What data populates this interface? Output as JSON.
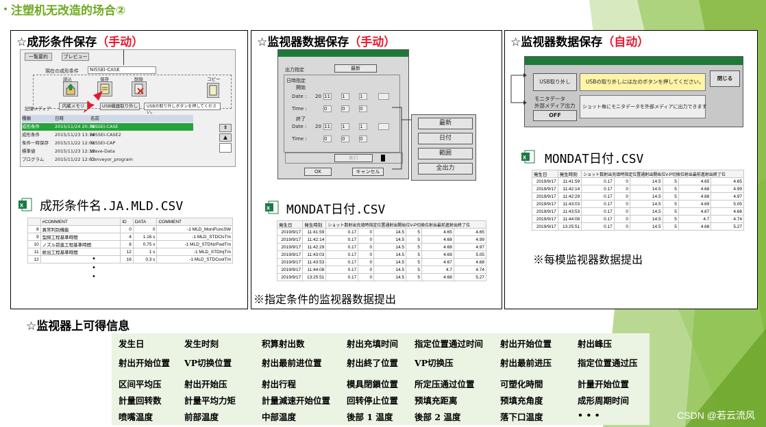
{
  "page": {
    "title": "注塑机无改造的场合②"
  },
  "panels": [
    {
      "title": "☆成形条件保存",
      "mode": "（手动）"
    },
    {
      "title": "☆监视器数据保存",
      "mode": "（手动）"
    },
    {
      "title": "☆监视器数据保存",
      "mode": "（自动）"
    }
  ],
  "screen1": {
    "menu_btn": "一覧要約",
    "preview_btn": "プレビュー",
    "current_label": "現在の成形条件",
    "current_value": "NISSEI-CASE",
    "load": "読込",
    "save": "保存",
    "delete": "削除",
    "copy": "コピー",
    "media_label": "記憶メディア",
    "internal_btn": "内蔵メモリ",
    "usb_btn": "USB機器取り外し",
    "usb_msg": "USBの取り外しボタンを押してください。",
    "headers": [
      "種類",
      "日時",
      "名前"
    ],
    "rows": [
      [
        "成形条件",
        "2015/11/24 20:35",
        "NISSEI-CASE"
      ],
      [
        "成形条件",
        "2015/11/23 13:14",
        "NISSEI-CASE2"
      ],
      [
        "条件一時保存",
        "2015/11/22 12:01",
        "NISSEI-CAP"
      ],
      [
        "標準値",
        "2015/11/23 12:13",
        "Wave-Data"
      ],
      [
        "プログラム",
        "2015/11/22 12:03",
        "Conveyor_program"
      ]
    ]
  },
  "file1": {
    "label": "成形条件名.JA.MLD.CSV",
    "headers": [
      "",
      "#COMMENT",
      "ID",
      "DATA",
      "COMMENT"
    ],
    "rows": [
      [
        "8",
        "異常判別機能",
        "0",
        "0",
        "-1 MLD_MoniFuncSW"
      ],
      [
        "9",
        "型締工程基準時間",
        "4",
        "1.16 s",
        "-1 MLD_STDClsTm"
      ],
      [
        "10",
        "ノズル前進工程基準時間",
        "8",
        "0.75 s",
        "-1 MLD_STDNzFwdTm"
      ],
      [
        "11",
        "射出工程基準時間",
        "12",
        "1 s",
        "-1 MLD_STDInjTm"
      ],
      [
        "12",
        "",
        "16",
        "0.3 s",
        "-1 MLD_STDCoolTm"
      ]
    ],
    "dots": [
      "•",
      "•",
      "•"
    ]
  },
  "screen2": {
    "output_label": "出力指定",
    "latest_btn": "最新",
    "date_spec": "日時指定",
    "start": "開始",
    "end": "終了",
    "date_label": "Date :",
    "time_label": "Time :",
    "year_prefix": "20",
    "values_a": [
      "11",
      "1",
      "1"
    ],
    "values_b": [
      "0",
      "0",
      "0"
    ],
    "exec_btn": "実行",
    "ok_btn": "OK",
    "cancel_btn": "キャンセル"
  },
  "screen2b": {
    "buttons": [
      "最新",
      "日付",
      "範囲",
      "全出力"
    ]
  },
  "monitor_table": {
    "headers": [
      "発生日",
      "発生時刻",
      "ショット数",
      "射出充填時間",
      "指定位置通過時間",
      "射出開始位置",
      "V-P切換位置",
      "射出最前進位置",
      "射出終了位置"
    ],
    "header_text": "ショット数射出充填時指定位置通射出開始位V-P切換位射出最前進射出終了位",
    "rows": [
      [
        "2019/9/17",
        "11:41:59",
        "0.17",
        "0",
        "14.5",
        "5",
        "4.65",
        "4.65"
      ],
      [
        "2019/9/17",
        "11:42:14",
        "0.17",
        "0",
        "14.5",
        "5",
        "4.68",
        "4.99"
      ],
      [
        "2019/9/17",
        "11:42:29",
        "0.17",
        "0",
        "14.5",
        "5",
        "4.68",
        "4.97"
      ],
      [
        "2019/9/17",
        "11:43:03",
        "0.17",
        "0",
        "14.5",
        "5",
        "4.69",
        "5.05"
      ],
      [
        "2019/9/17",
        "11:43:53",
        "0.17",
        "0",
        "14.5",
        "5",
        "4.67",
        "4.68"
      ],
      [
        "2019/9/17",
        "11:44:08",
        "0.17",
        "0",
        "14.5",
        "5",
        "4.7",
        "4.74"
      ],
      [
        "2019/9/17",
        "13:25:51",
        "0.17",
        "0",
        "14.5",
        "5",
        "4.68",
        "5.27"
      ]
    ]
  },
  "file2": {
    "label": "MONDAT日付.CSV",
    "note": "※指定条件的监视器数据提出"
  },
  "screen3": {
    "usb_btn": "USB取り外し",
    "usb_msg": "USBの取り外しには左のボタンを押してください。",
    "close_btn": "閉じる",
    "monitor_label1": "モニタデータ",
    "monitor_label2": "外部メディア出力",
    "off": "OFF",
    "shot_msg": "ショット毎にモニタデータを外部メディアに出力できます"
  },
  "file3": {
    "label": "MONDAT日付.CSV",
    "note": "※每模监视器数据提出"
  },
  "info": {
    "title": "☆监视器上可得信息",
    "rows": [
      [
        "发生日",
        "发生时刻",
        "积算射出数",
        "射出充填时间",
        "指定位置通过时间",
        "射出开始位置",
        "射出峰压"
      ],
      [
        "射出开始位置",
        "VP切换位置",
        "射出最前进位置",
        "射出終了位置",
        "VP切换压",
        "射出最前进压",
        "指定位置通过压"
      ],
      [
        "区间平均压",
        "射出开始压",
        "射出行程",
        "模具閉鎖位置",
        "所定压通过位置",
        "可塑化時間",
        "計量开始位置"
      ],
      [
        "計量回转数",
        "計量平均力矩",
        "計量減速开始位置",
        "回转停止位置",
        "预填充距离",
        "预填充角度",
        "成形周期时间"
      ],
      [
        "喷嘴温度",
        "前部温度",
        "中部温度",
        "後部 1 温度",
        "後部 2 温度",
        "落下口温度",
        "• • •"
      ]
    ]
  },
  "watermark": "CSDN @若云流风",
  "colors": {
    "accent_green": "#6faa1f",
    "red": "#e8182c",
    "dialog_green": "#1f7a3a",
    "grid_bg": "#ebf3e2"
  }
}
